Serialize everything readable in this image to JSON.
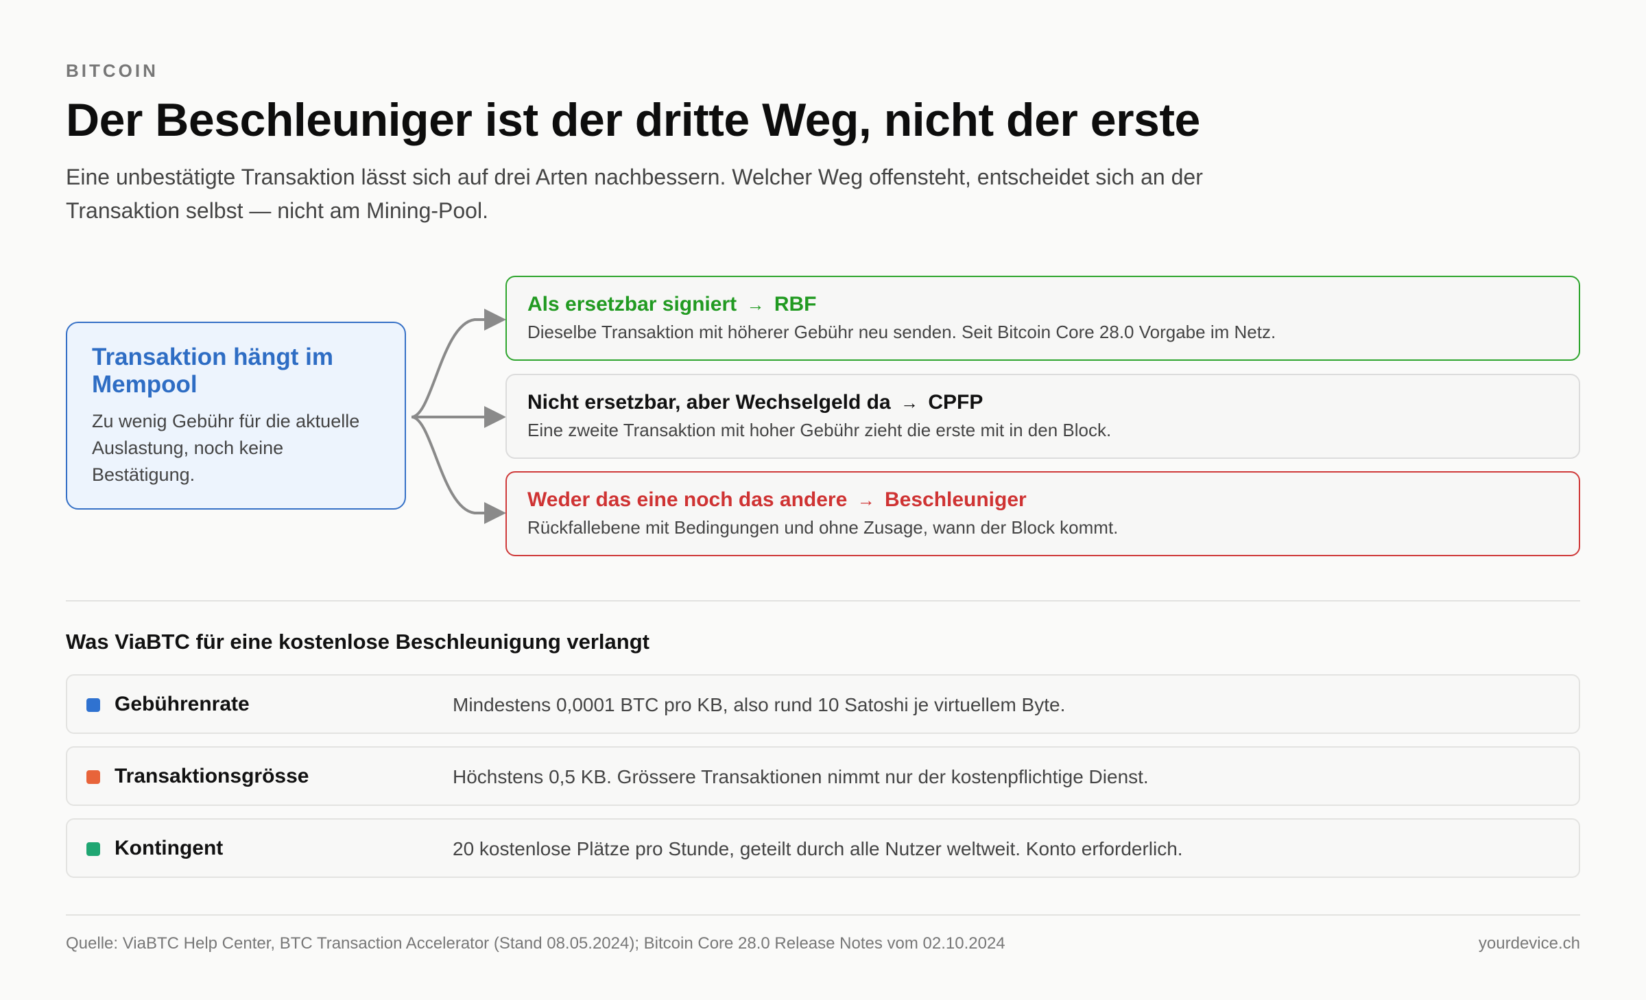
{
  "header": {
    "kicker": "BITCOIN",
    "title": "Der Beschleuniger ist der dritte Weg, nicht der erste",
    "subtitle": "Eine unbestätigte Transaktion lässt sich auf drei Arten nachbessern. Welcher Weg offensteht, entscheidet sich an der Transaktion selbst — nicht am Mining-Pool."
  },
  "diagram": {
    "source": {
      "title": "Transaktion hängt im Mempool",
      "text": "Zu wenig Gebühr für die aktuelle Auslastung, noch keine Bestätigung."
    },
    "arrow_glyph": "→",
    "options": [
      {
        "condition": "Als ersetzbar signiert",
        "method": "RBF",
        "text": "Dieselbe Transaktion mit höherer Gebühr neu senden. Seit Bitcoin Core 28.0 Vorgabe im Netz.",
        "color": "#2ea52e"
      },
      {
        "condition": "Nicht ersetzbar, aber Wechselgeld da",
        "method": "CPFP",
        "text": "Eine zweite Transaktion mit hoher Gebühr zieht die erste mit in den Block.",
        "color": "#dcdcdc"
      },
      {
        "condition": "Weder das eine noch das andere",
        "method": "Beschleuniger",
        "text": "Rückfallebene mit Bedingungen und ohne Zusage, wann der Block kommt.",
        "color": "#cf3a3a"
      }
    ]
  },
  "requirements": {
    "heading": "Was ViaBTC für eine kostenlose Beschleunigung verlangt",
    "rows": [
      {
        "label": "Gebührenrate",
        "value": "Mindestens 0,0001 BTC pro KB, also rund 10 Satoshi je virtuellem Byte.",
        "color": "#2f72d0"
      },
      {
        "label": "Transaktionsgrösse",
        "value": "Höchstens 0,5 KB. Grössere Transaktionen nimmt nur der kostenpflichtige Dienst.",
        "color": "#e8643a"
      },
      {
        "label": "Kontingent",
        "value": "20 kostenlose Plätze pro Stunde, geteilt durch alle Nutzer weltweit. Konto erforderlich.",
        "color": "#1fa672"
      }
    ]
  },
  "footer": {
    "source": "Quelle: ViaBTC Help Center, BTC Transaction Accelerator (Stand 08.05.2024); Bitcoin Core 28.0 Release Notes vom 02.10.2024",
    "brand": "yourdevice.ch"
  }
}
